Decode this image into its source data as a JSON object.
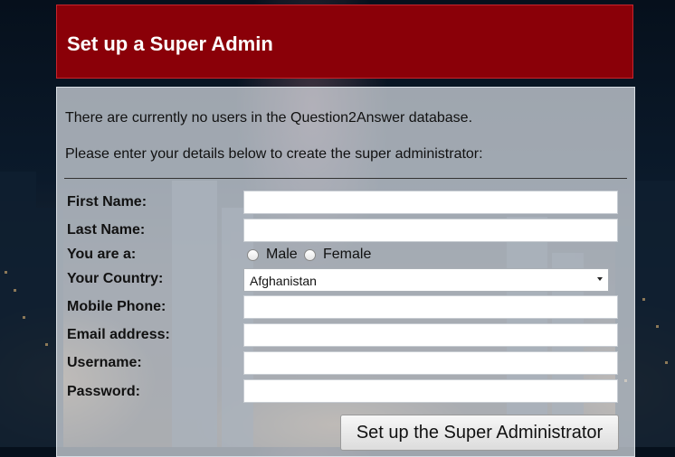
{
  "header": {
    "title": "Set up a Super Admin"
  },
  "intro": {
    "line1": "There are currently no users in the Question2Answer database.",
    "line2": "Please enter your details below to create the super administrator:"
  },
  "form": {
    "first_name_label": "First Name:",
    "last_name_label": "Last Name:",
    "gender_label": "You are a:",
    "gender_options": [
      "Male",
      "Female"
    ],
    "country_label": "Your Country:",
    "country_value": "Afghanistan",
    "mobile_label": "Mobile Phone:",
    "email_label": "Email address:",
    "username_label": "Username:",
    "password_label": "Password:",
    "submit_label": "Set up the Super Administrator"
  },
  "colors": {
    "header_bg": "#8a0008",
    "panel_bg": "rgba(232,236,242,0.68)"
  }
}
